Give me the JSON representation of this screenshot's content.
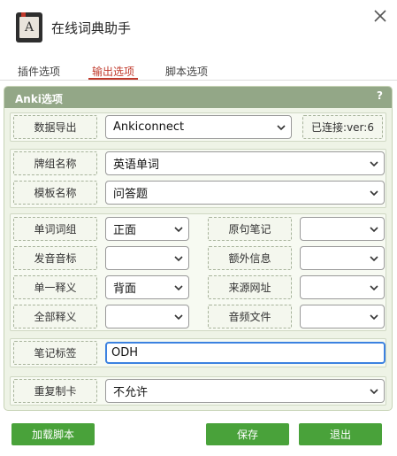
{
  "app": {
    "title": "在线词典助手",
    "icon_letter": "A"
  },
  "tabs": [
    {
      "label": "插件选项"
    },
    {
      "label": "输出选项"
    },
    {
      "label": "脚本选项"
    }
  ],
  "panel": {
    "title": "Anki选项",
    "help": "?"
  },
  "export": {
    "label": "数据导出",
    "value": "Ankiconnect",
    "status": "已连接:ver:6"
  },
  "deck": {
    "label": "牌组名称",
    "value": "英语单词"
  },
  "model": {
    "label": "模板名称",
    "value": "问答题"
  },
  "fields": {
    "word": {
      "label": "单词词组",
      "value": "正面"
    },
    "sentence": {
      "label": "原句笔记",
      "value": ""
    },
    "phonetic": {
      "label": "发音音标",
      "value": ""
    },
    "extra": {
      "label": "额外信息",
      "value": ""
    },
    "single_def": {
      "label": "单一释义",
      "value": "背面"
    },
    "url": {
      "label": "来源网址",
      "value": ""
    },
    "all_defs": {
      "label": "全部释义",
      "value": ""
    },
    "audio": {
      "label": "音频文件",
      "value": ""
    }
  },
  "tags": {
    "label": "笔记标签",
    "value": "ODH"
  },
  "duplicate": {
    "label": "重复制卡",
    "value": "不允许"
  },
  "buttons": {
    "load_script": "加载脚本",
    "save": "保存",
    "exit": "退出"
  },
  "colors": {
    "accent_red": "#c0392b",
    "button_green": "#49a23a",
    "panel_header": "#93a787",
    "focus_blue": "#3c82e0"
  }
}
